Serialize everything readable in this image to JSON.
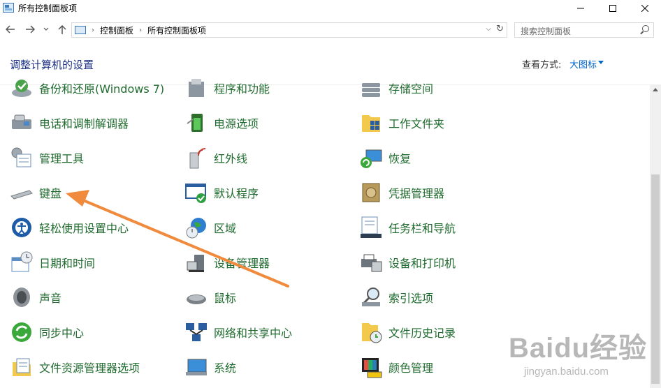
{
  "window": {
    "title": "所有控制面板项",
    "minimize_icon": "minimize-icon",
    "maximize_icon": "maximize-icon",
    "close_icon": "close-icon"
  },
  "navigation": {
    "back_icon": "back-arrow-icon",
    "forward_icon": "forward-arrow-icon",
    "recent_icon": "chevron-down-icon",
    "up_icon": "up-arrow-icon"
  },
  "address": {
    "crumbs": [
      "控制面板",
      "所有控制面板项"
    ]
  },
  "search": {
    "placeholder": "搜索控制面板"
  },
  "header": {
    "title": "调整计算机的设置",
    "view_by_label": "查看方式:",
    "view_by_value": "大图标"
  },
  "items": {
    "col1": [
      "备份和还原(Windows 7)",
      "电话和调制解调器",
      "管理工具",
      "键盘",
      "轻松使用设置中心",
      "日期和时间",
      "声音",
      "同步中心",
      "文件资源管理器选项"
    ],
    "col2": [
      "程序和功能",
      "电源选项",
      "红外线",
      "默认程序",
      "区域",
      "设备管理器",
      "鼠标",
      "网络和共享中心",
      "系统"
    ],
    "col3": [
      "存储空间",
      "工作文件夹",
      "恢复",
      "凭据管理器",
      "任务栏和导航",
      "设备和打印机",
      "索引选项",
      "文件历史记录",
      "颜色管理"
    ]
  },
  "watermark": {
    "logo": "Baidu经验",
    "url": "jingyan.baidu.com"
  },
  "colors": {
    "item_label": "#1f6b2e",
    "page_title": "#1e3287",
    "link": "#0066cc",
    "arrow": "#f08a3c"
  }
}
